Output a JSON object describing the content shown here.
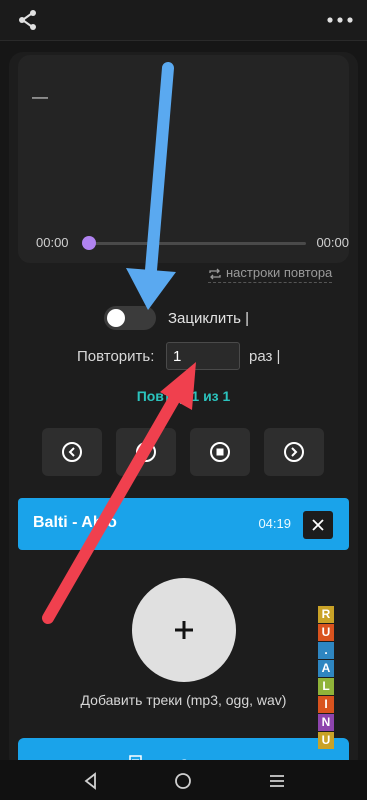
{
  "player": {
    "title": "—",
    "time_start": "00:00",
    "time_end": "00:00",
    "progress": 0,
    "repeat_settings": "настроки повтора"
  },
  "loop": {
    "label": "Зациклить |",
    "on": false
  },
  "repeat": {
    "label": "Повторить:",
    "value": "1",
    "times_label": "раз |",
    "status": "Повтор 1 из 1"
  },
  "controls": [
    "prev-icon",
    "play-icon",
    "stop-icon",
    "next-icon"
  ],
  "track": {
    "name": "Balti - Ahlo",
    "duration": "04:19"
  },
  "add": {
    "label": "Добавить треки (mp3, ogg, wav)"
  },
  "bottom_button": {
    "label": "З..."
  },
  "watermark": {
    "letters": [
      "R",
      "U",
      ".",
      "A",
      "L",
      "I",
      "N",
      "U"
    ],
    "colors": [
      "#c9a227",
      "#d9531e",
      "#2e86c1",
      "#2e86c1",
      "#8fb339",
      "#d9531e",
      "#8e44ad",
      "#c9a227"
    ]
  },
  "colors": {
    "accent": "#1aa3ea",
    "teal": "#2bc3bd",
    "thumb": "#b083f0",
    "arrow_blue": "#5aa9f0",
    "arrow_red": "#f0404e"
  }
}
